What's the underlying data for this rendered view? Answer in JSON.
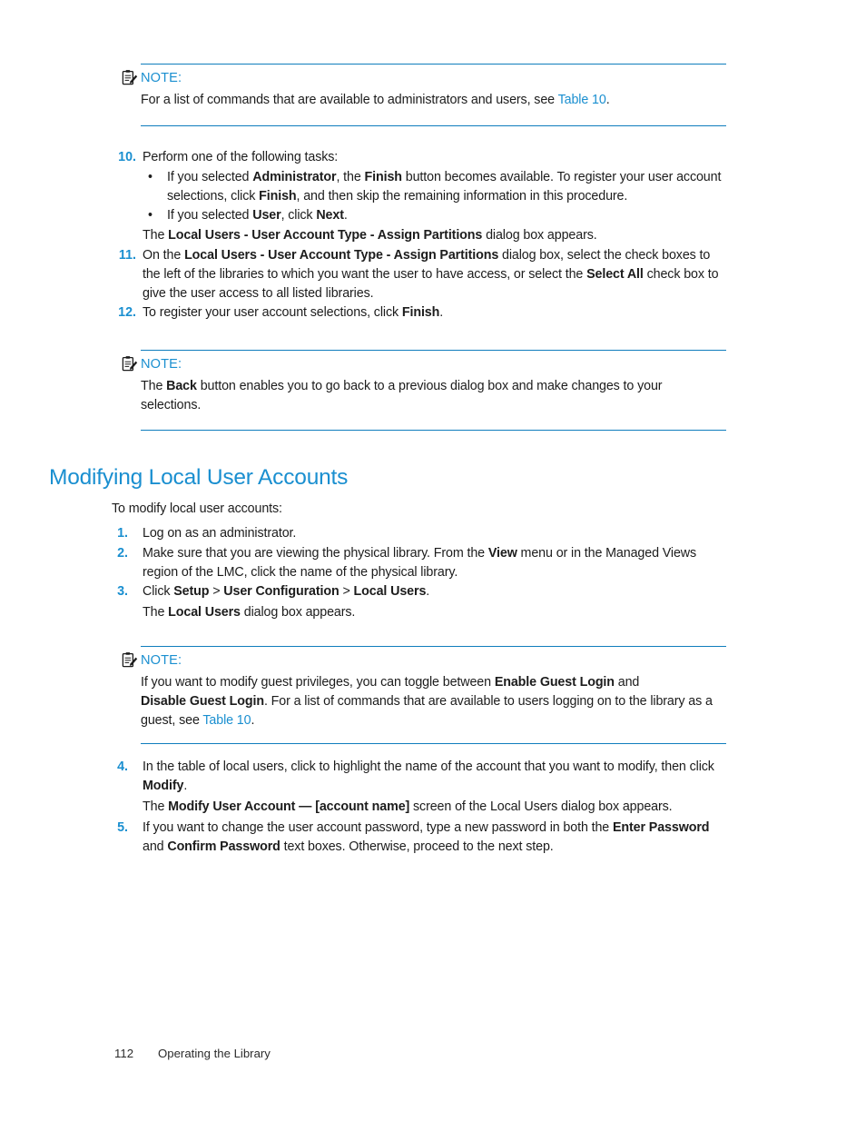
{
  "page": {
    "number": "112",
    "running_title": "Operating the Library"
  },
  "notes": {
    "label": "NOTE:",
    "icon": "note-clipboard-icon",
    "note1_pre": "For a list of commands that are available to administrators and users, see ",
    "note1_link": "Table 10",
    "note1_post": ".",
    "note2_pre": "The ",
    "note2_bold": "Back",
    "note2_post": " button enables you to go back to a previous dialog box and make changes to your selections.",
    "note3_line1_pre": "If you want to modify guest privileges, you can toggle between ",
    "note3_bold1": "Enable Guest Login",
    "note3_line1_mid": " and ",
    "note3_bold2": "Disable Guest Login",
    "note3_line1_post": ". For a list of commands that are available to users logging on to the library as a guest, see ",
    "note3_link": "Table 10",
    "note3_end": "."
  },
  "steps_top": [
    {
      "num": "10.",
      "text": "Perform one of the following tasks:",
      "bullets": [
        {
          "seg1": "If you selected ",
          "b1": "Administrator",
          "seg2": ", the ",
          "b2": "Finish",
          "seg3": " button becomes available. To register your user account selections, click ",
          "b3": "Finish",
          "seg4": ", and then skip the remaining information in this procedure."
        },
        {
          "seg1": "If you selected ",
          "b1": "User",
          "seg2": ", click ",
          "b2": "Next",
          "seg3": ".",
          "b3": "",
          "seg4": ""
        }
      ],
      "cont_pre": "The ",
      "cont_bold": "Local Users - User Account Type - Assign Partitions",
      "cont_post": " dialog box appears."
    },
    {
      "num": "11.",
      "seg1": "On the ",
      "b1": "Local Users - User Account Type - Assign Partitions",
      "seg2": " dialog box, select the check boxes to the left of the libraries to which you want the user to have access, or select the ",
      "b2": "Select All",
      "seg3": " check box to give the user access to all listed libraries."
    },
    {
      "num": "12.",
      "seg1": "To register your user account selections, click ",
      "b1": "Finish",
      "seg2": "."
    }
  ],
  "section": {
    "heading": "Modifying Local User Accounts",
    "intro": "To modify local user accounts:",
    "steps": [
      {
        "num": "1.",
        "text": "Log on as an administrator."
      },
      {
        "num": "2.",
        "seg1": "Make sure that you are viewing the physical library. From the ",
        "b1": "View",
        "seg2": " menu or in the Managed Views region of the LMC, click the name of the physical library."
      },
      {
        "num": "3.",
        "seg1": "Click ",
        "b1": "Setup",
        "sep1": " > ",
        "b2": "User Configuration",
        "sep2": " > ",
        "b3": "Local Users",
        "seg2": ".",
        "cont_pre": "The ",
        "cont_bold": "Local Users",
        "cont_post": " dialog box appears."
      },
      {
        "num": "4.",
        "seg1": "In the table of local users, click to highlight the name of the account that you want to modify, then click ",
        "b1": "Modify",
        "seg2": ".",
        "cont_pre": "The ",
        "cont_bold": "Modify User Account — [account name]",
        "cont_post": " screen of the Local Users dialog box appears."
      },
      {
        "num": "5.",
        "seg1": "If you want to change the user account password, type a new password in both the ",
        "b1": "Enter Password",
        "seg2": " and ",
        "b2": "Confirm Password",
        "seg3": " text boxes. Otherwise, proceed to the next step."
      }
    ]
  },
  "colors": {
    "accent": "#1a8fd0",
    "rule": "#0f7dbd",
    "body": "#1c1c1c"
  }
}
